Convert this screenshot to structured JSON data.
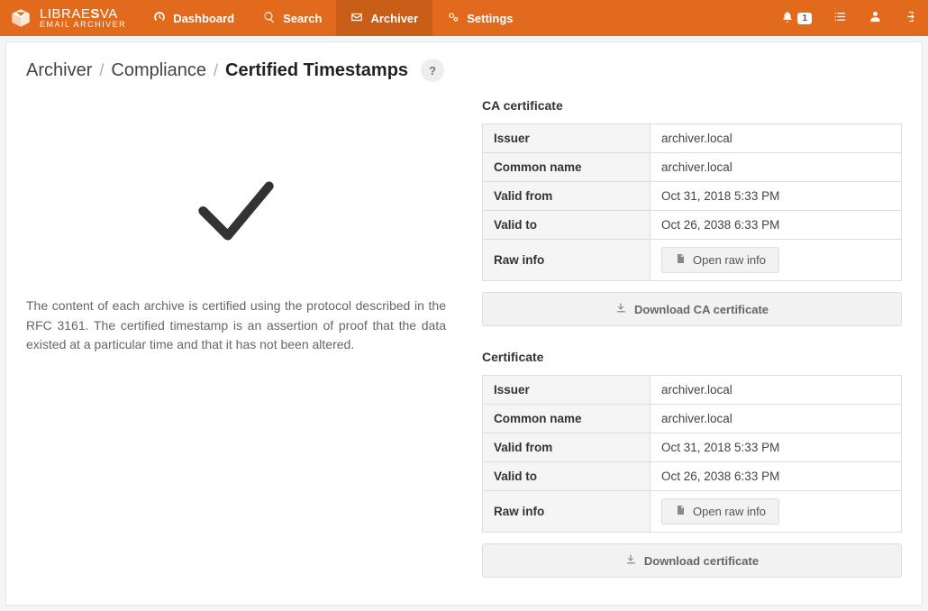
{
  "brand": {
    "line1_a": "LIBRAE",
    "line1_b": "S",
    "line1_c": "VA",
    "line2": "EMAIL ARCHIVER"
  },
  "nav": {
    "dashboard": "Dashboard",
    "search": "Search",
    "archiver": "Archiver",
    "settings": "Settings",
    "notif_count": "1"
  },
  "crumbs": {
    "a": "Archiver",
    "b": "Compliance",
    "c": "Certified Timestamps",
    "help": "?"
  },
  "description": "The content of each archive is certified using the protocol described in the RFC 3161. The certified timestamp is an assertion of proof that the data existed at a particular time and that it has not been altered.",
  "labels": {
    "issuer": "Issuer",
    "common_name": "Common name",
    "valid_from": "Valid from",
    "valid_to": "Valid to",
    "raw_info": "Raw info",
    "open_raw": "Open raw info"
  },
  "ca": {
    "title": "CA certificate",
    "issuer": "archiver.local",
    "common_name": "archiver.local",
    "valid_from": "Oct 31, 2018 5:33 PM",
    "valid_to": "Oct 26, 2038 6:33 PM",
    "download": "Download CA certificate"
  },
  "cert": {
    "title": "Certificate",
    "issuer": "archiver.local",
    "common_name": "archiver.local",
    "valid_from": "Oct 31, 2018 5:33 PM",
    "valid_to": "Oct 26, 2038 6:33 PM",
    "download": "Download certificate"
  }
}
